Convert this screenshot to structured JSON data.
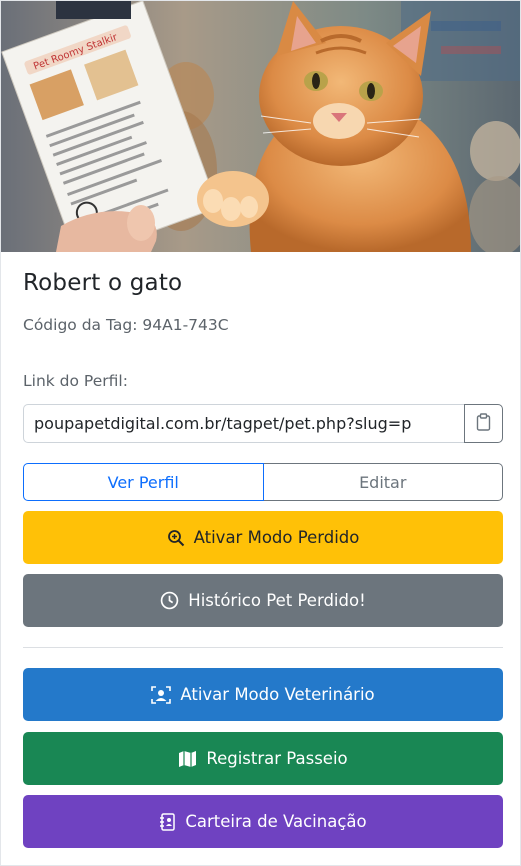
{
  "pet": {
    "name": "Robert o gato",
    "tag_label": "Código da Tag:",
    "tag_code": "94A1-743C"
  },
  "profile_link": {
    "label": "Link do Perfil:",
    "value": "poupapetdigital.com.br/tagpet/pet.php?slug=p"
  },
  "tabs": {
    "view": "Ver Perfil",
    "edit": "Editar"
  },
  "actions": {
    "lost_mode": "Ativar Modo Perdido",
    "lost_history": "Histórico Pet Perdido!",
    "vet_mode": "Ativar Modo Veterinário",
    "walk": "Registrar Passeio",
    "vaccination": "Carteira de Vacinação"
  },
  "hero_card": {
    "title": "Pet Roomy Stalkir"
  },
  "colors": {
    "primary": "#0d6efd",
    "warning": "#ffc107",
    "secondary": "#6c757d",
    "info": "#2479ca",
    "success": "#198754",
    "purple": "#6f42c1"
  },
  "icons": {
    "copy": "clipboard-icon",
    "lost": "search-zoom-icon",
    "history": "clock-icon",
    "vet": "person-badge-icon",
    "walk": "map-icon",
    "vaccination": "journal-icon"
  }
}
